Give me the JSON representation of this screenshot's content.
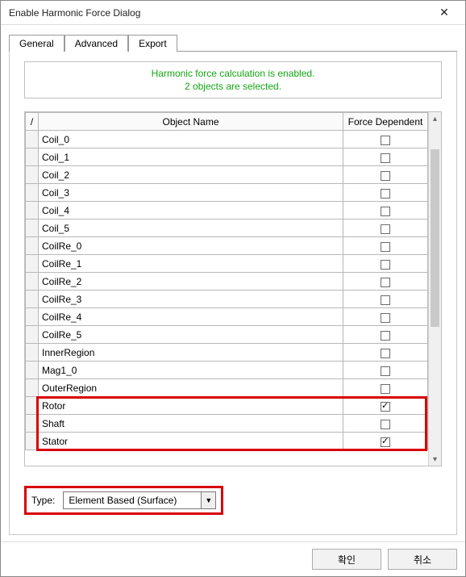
{
  "window": {
    "title": "Enable Harmonic Force Dialog"
  },
  "tabs": {
    "general": "General",
    "advanced": "Advanced",
    "export": "Export",
    "active": "general"
  },
  "status": {
    "line1": "Harmonic force calculation is enabled.",
    "line2": "2 objects are selected."
  },
  "table": {
    "headers": {
      "corner": "/",
      "object": "Object Name",
      "dependent": "Force Dependent"
    },
    "rows": [
      {
        "name": "Coil_0",
        "checked": false
      },
      {
        "name": "Coil_1",
        "checked": false
      },
      {
        "name": "Coil_2",
        "checked": false
      },
      {
        "name": "Coil_3",
        "checked": false
      },
      {
        "name": "Coil_4",
        "checked": false
      },
      {
        "name": "Coil_5",
        "checked": false
      },
      {
        "name": "CoilRe_0",
        "checked": false
      },
      {
        "name": "CoilRe_1",
        "checked": false
      },
      {
        "name": "CoilRe_2",
        "checked": false
      },
      {
        "name": "CoilRe_3",
        "checked": false
      },
      {
        "name": "CoilRe_4",
        "checked": false
      },
      {
        "name": "CoilRe_5",
        "checked": false
      },
      {
        "name": "InnerRegion",
        "checked": false
      },
      {
        "name": "Mag1_0",
        "checked": false
      },
      {
        "name": "OuterRegion",
        "checked": false
      },
      {
        "name": "Rotor",
        "checked": true
      },
      {
        "name": "Shaft",
        "checked": false
      },
      {
        "name": "Stator",
        "checked": true
      }
    ],
    "highlight_range": [
      15,
      17
    ]
  },
  "type": {
    "label": "Type:",
    "value": "Element Based (Surface)"
  },
  "buttons": {
    "ok": "확인",
    "cancel": "취소"
  }
}
